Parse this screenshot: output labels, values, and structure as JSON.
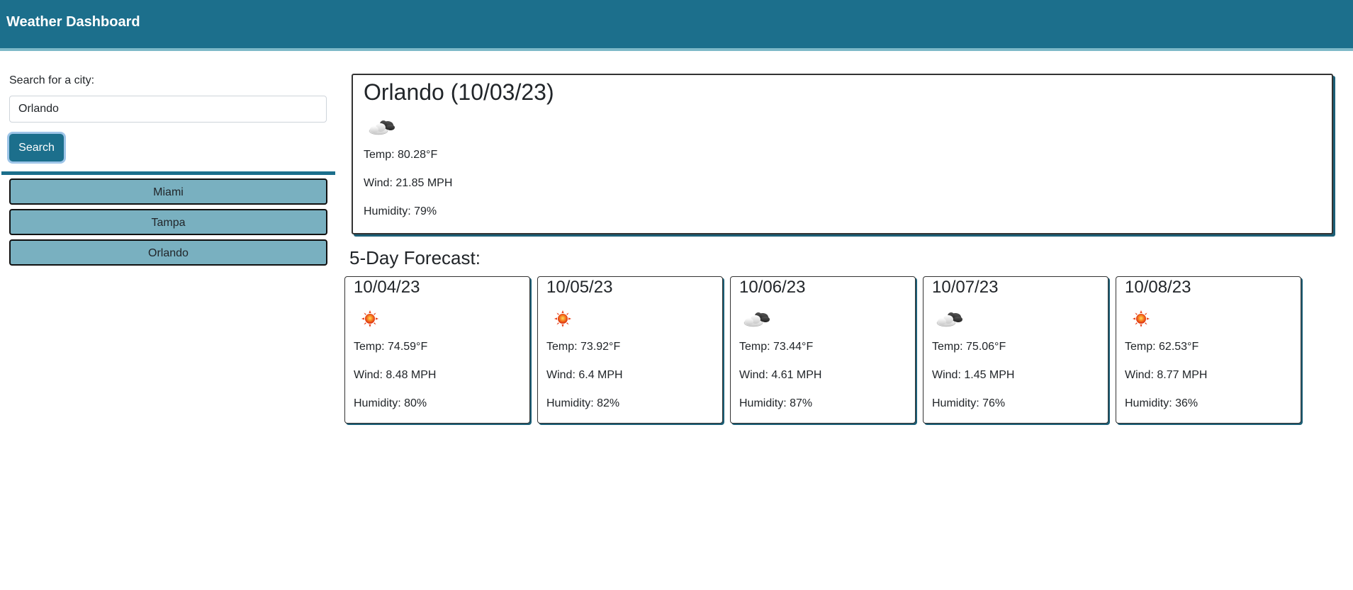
{
  "header": {
    "title": "Weather Dashboard"
  },
  "sidebar": {
    "search_label": "Search for a city:",
    "search_value": "Orlando",
    "search_button": "Search",
    "history": [
      "Miami",
      "Tampa",
      "Orlando"
    ]
  },
  "current": {
    "title": "Orlando (10/03/23)",
    "icon": "cloud-icon",
    "temp": "Temp: 80.28°F",
    "wind": "Wind: 21.85 MPH",
    "humidity": "Humidity: 79%"
  },
  "forecast": {
    "heading": "5-Day Forecast:",
    "days": [
      {
        "date": "10/04/23",
        "icon": "sun-icon",
        "temp": "Temp: 74.59°F",
        "wind": "Wind: 8.48 MPH",
        "humidity": "Humidity: 80%"
      },
      {
        "date": "10/05/23",
        "icon": "sun-icon",
        "temp": "Temp: 73.92°F",
        "wind": "Wind: 6.4 MPH",
        "humidity": "Humidity: 82%"
      },
      {
        "date": "10/06/23",
        "icon": "cloud-icon",
        "temp": "Temp: 73.44°F",
        "wind": "Wind: 4.61 MPH",
        "humidity": "Humidity: 87%"
      },
      {
        "date": "10/07/23",
        "icon": "cloud-icon",
        "temp": "Temp: 75.06°F",
        "wind": "Wind: 1.45 MPH",
        "humidity": "Humidity: 76%"
      },
      {
        "date": "10/08/23",
        "icon": "sun-icon",
        "temp": "Temp: 62.53°F",
        "wind": "Wind: 8.77 MPH",
        "humidity": "Humidity: 36%"
      }
    ]
  },
  "colors": {
    "header_bg": "#1c6f8c",
    "history_button_bg": "#79b0c0",
    "accent": "#1c6f8c"
  }
}
